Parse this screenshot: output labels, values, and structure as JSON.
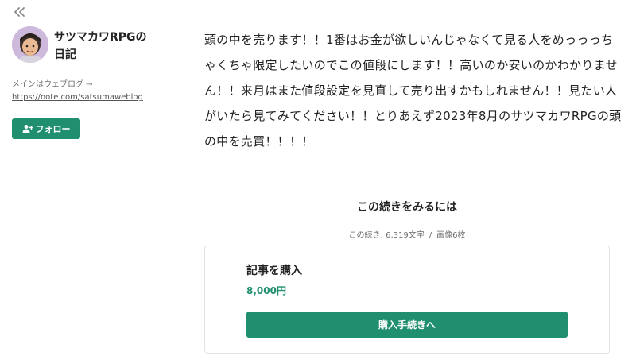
{
  "nav": {
    "collapse_icon": "double-chevron-left-icon"
  },
  "profile": {
    "name_line1": "サツマカワRPGの",
    "name_line2": "日記",
    "sub_note": "メインはウェブログ →",
    "sub_link": "https://note.com/satsumaweblog",
    "follow_label": "フォロー",
    "follow_icon": "user-plus-icon"
  },
  "article": {
    "body": "頭の中を売ります！！1番はお金が欲しいんじゃなくて見る人をめっっっちゃくちゃ限定したいのでこの値段にします！！高いのか安いのかわかりません！！来月はまた値段設定を見直して売り出すかもしれません！！見たい人がいたら見てみてください！！とりあえず2023年8月のサツマカワRPGの頭の中を売買！！！！"
  },
  "paywall": {
    "heading": "この続きをみるには",
    "remaining": "この続き: 6,319文字",
    "separator": "/",
    "images": "画像6枚",
    "card_title": "記事を購入",
    "price": "8,000円",
    "buy_label": "購入手続きへ"
  },
  "colors": {
    "accent": "#1f8f6f",
    "border": "#e2e2e2",
    "text": "#222222"
  }
}
